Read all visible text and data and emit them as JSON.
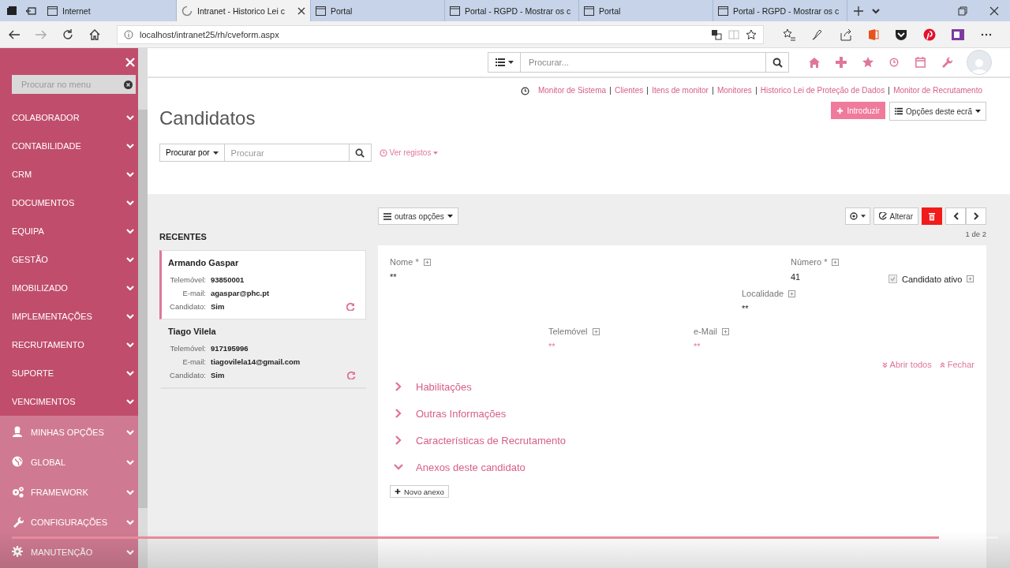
{
  "browser": {
    "tabs": [
      {
        "label": "Internet",
        "selected": false,
        "loading": false
      },
      {
        "label": "Intranet - Historico Lei c",
        "selected": true,
        "loading": true
      },
      {
        "label": "Portal",
        "selected": false,
        "loading": false
      },
      {
        "label": "Portal - RGPD - Mostrar os c",
        "selected": false,
        "loading": false
      },
      {
        "label": "Portal",
        "selected": false,
        "loading": false
      },
      {
        "label": "Portal - RGPD - Mostrar os c",
        "selected": false,
        "loading": false
      }
    ],
    "address": "localhost/intranet25/rh/cveform.aspx"
  },
  "sidebar": {
    "search_placeholder": "Procurar no menu",
    "items": [
      {
        "label": "COLABORADOR",
        "kind": "module"
      },
      {
        "label": "CONTABILIDADE",
        "kind": "module"
      },
      {
        "label": "CRM",
        "kind": "module"
      },
      {
        "label": "DOCUMENTOS",
        "kind": "module"
      },
      {
        "label": "EQUIPA",
        "kind": "module"
      },
      {
        "label": "GESTÃO",
        "kind": "module"
      },
      {
        "label": "IMOBILIZADO",
        "kind": "module"
      },
      {
        "label": "IMPLEMENTAÇÕES",
        "kind": "module"
      },
      {
        "label": "RECRUTAMENTO",
        "kind": "module"
      },
      {
        "label": "SUPORTE",
        "kind": "module"
      },
      {
        "label": "VENCIMENTOS",
        "kind": "module"
      },
      {
        "label": "MINHAS OPÇÕES",
        "kind": "group"
      },
      {
        "label": "GLOBAL",
        "kind": "group"
      },
      {
        "label": "FRAMEWORK",
        "kind": "group"
      },
      {
        "label": "CONFIGURAÇÕES",
        "kind": "group"
      },
      {
        "label": "MANUTENÇÃO",
        "kind": "group"
      }
    ]
  },
  "topbar": {
    "search_placeholder": "Procurar..."
  },
  "links": [
    "Monitor de Sistema",
    "Clientes",
    "Itens de monitor",
    "Monitores",
    "Historico Lei de Proteção de Dados",
    "Monitor de Recrutamento"
  ],
  "title": "Candidatos",
  "actions": {
    "new": "Introduzir",
    "screen_options": "Opções deste ecrã"
  },
  "search": {
    "by": "Procurar por",
    "placeholder": "Procurar",
    "records": "Ver registos"
  },
  "toolbar": {
    "other_options": "outras opções",
    "edit": "Alterar",
    "pager": "1 de 2"
  },
  "recent": {
    "title": "RECENTES",
    "items": [
      {
        "name": "Armando Gaspar",
        "selected": true,
        "fields": [
          {
            "label": "Telemóvel:",
            "value": "93850001"
          },
          {
            "label": "E-mail:",
            "value": "agaspar@phc.pt"
          },
          {
            "label": "Candidato:",
            "value": "Sim"
          }
        ]
      },
      {
        "name": "Tiago Vilela",
        "selected": false,
        "fields": [
          {
            "label": "Telemóvel:",
            "value": "917195996"
          },
          {
            "label": "E-mail:",
            "value": "tiagovilela14@gmail.com"
          },
          {
            "label": "Candidato:",
            "value": "Sim"
          }
        ]
      }
    ]
  },
  "form": {
    "fields": [
      {
        "label": "Nome *",
        "value": "**",
        "kind": "text"
      },
      {
        "label": "Número *",
        "value": "41",
        "kind": "text"
      },
      {
        "label": "Candidato ativo",
        "kind": "checkbox",
        "checked": true
      },
      {
        "label": "Localidade",
        "value": "**",
        "kind": "text"
      },
      {
        "label": "Telemóvel",
        "value": "**",
        "kind": "link"
      },
      {
        "label": "e-Mail",
        "value": "**",
        "kind": "link"
      }
    ],
    "expand_all": "Abrir todos",
    "collapse": "Fechar",
    "sections": [
      {
        "label": "Habilitações",
        "expanded": false
      },
      {
        "label": "Outras Informações",
        "expanded": false
      },
      {
        "label": "Características de Recrutamento",
        "expanded": false
      },
      {
        "label": "Anexos deste candidato",
        "expanded": true
      }
    ],
    "add_attachment": "Novo anexo"
  },
  "video": {
    "level": 0.94
  }
}
